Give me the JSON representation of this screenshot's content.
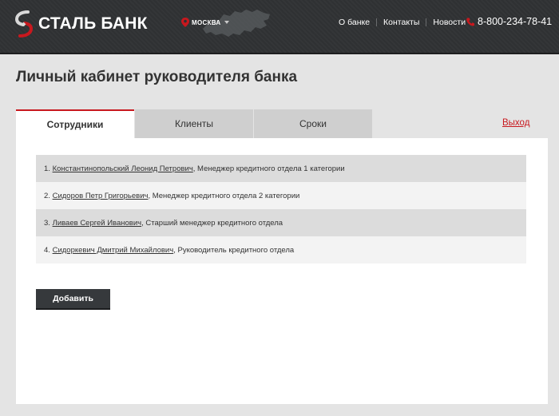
{
  "header": {
    "logo_text": "СТАЛЬ БАНК",
    "city": "МОСКВА",
    "nav": [
      "О банке",
      "Контакты",
      "Новости"
    ],
    "phone": "8-800-234-78-41",
    "accent_color": "#c8181e"
  },
  "page_title": "Личный кабинет руководителя банка",
  "tabs": [
    {
      "label": "Сотрудники",
      "active": true
    },
    {
      "label": "Клиенты",
      "active": false
    },
    {
      "label": "Сроки",
      "active": false
    }
  ],
  "logout": "Выход",
  "employees": [
    {
      "num": "1.",
      "name": "Константинопольский Леонид Петрович",
      "role": ", Менеджер кредитного отдела 1 категории"
    },
    {
      "num": "2.",
      "name": "Сидоров Петр Григорьевич",
      "role": ", Менеджер кредитного отдела 2 категории"
    },
    {
      "num": "3.",
      "name": "Ливаев Сергей Иванович",
      "role": ", Старший менеджер кредитного отдела"
    },
    {
      "num": "4.",
      "name": "Сидоркевич Дмитрий Михайлович",
      "role": ", Руководитель кредитного отдела"
    }
  ],
  "add_button": "Добавить",
  "icons": [
    "logo-icon",
    "location-pin-icon",
    "chevron-down-icon",
    "russia-map-icon",
    "phone-icon"
  ]
}
